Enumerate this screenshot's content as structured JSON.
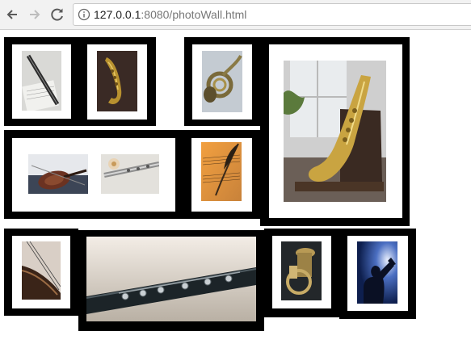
{
  "browser": {
    "url_host": "127.0.0.1",
    "url_rest": ":8080/photoWall.html"
  },
  "photos": [
    {
      "name": "clarinet-on-sheet-music"
    },
    {
      "name": "saxophone-dark"
    },
    {
      "name": "french-horn"
    },
    {
      "name": "saxophone-on-chair"
    },
    {
      "name": "violin"
    },
    {
      "name": "flute-with-flower"
    },
    {
      "name": "sheet-music-with-quill"
    },
    {
      "name": "violin-scroll"
    },
    {
      "name": "clarinet-closeup"
    },
    {
      "name": "tuba"
    },
    {
      "name": "trumpeter-silhouette"
    }
  ]
}
